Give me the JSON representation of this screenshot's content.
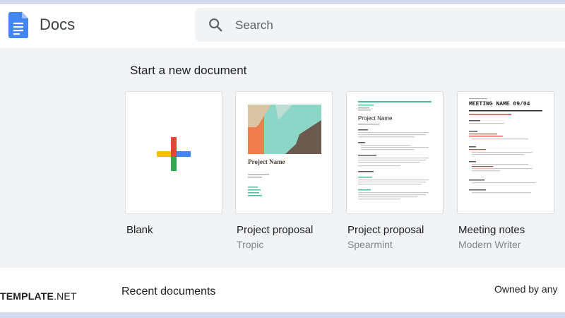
{
  "app": {
    "name": "Docs"
  },
  "search": {
    "placeholder": "Search"
  },
  "start": {
    "title": "Start a new document",
    "templates": [
      {
        "name": "Blank",
        "subtitle": ""
      },
      {
        "name": "Project proposal",
        "subtitle": "Tropic"
      },
      {
        "name": "Project proposal",
        "subtitle": "Spearmint"
      },
      {
        "name": "Meeting notes",
        "subtitle": "Modern Writer"
      }
    ]
  },
  "thumbnails": {
    "tropic": {
      "title": "Project Name"
    },
    "spearmint": {
      "title": "Project Name"
    },
    "modern_writer": {
      "title": "MEETING NAME 09/04"
    }
  },
  "recent": {
    "title": "Recent documents",
    "owned_by": "Owned by any"
  },
  "watermark": {
    "brand_bold": "TEMPLATE",
    "brand_rest": ".NET"
  },
  "colors": {
    "docs_blue": "#4285f4",
    "google_red": "#ea4335",
    "google_yellow": "#fbbc04",
    "google_green": "#34a853",
    "spearmint_accent": "#4eb89a",
    "tropic_teal": "#8bd6c6",
    "tropic_orange": "#f07d4b",
    "modern_red": "#e53935"
  },
  "icons": {
    "logo": "docs-logo-icon",
    "search": "search-icon",
    "blank": "plus-icon"
  }
}
